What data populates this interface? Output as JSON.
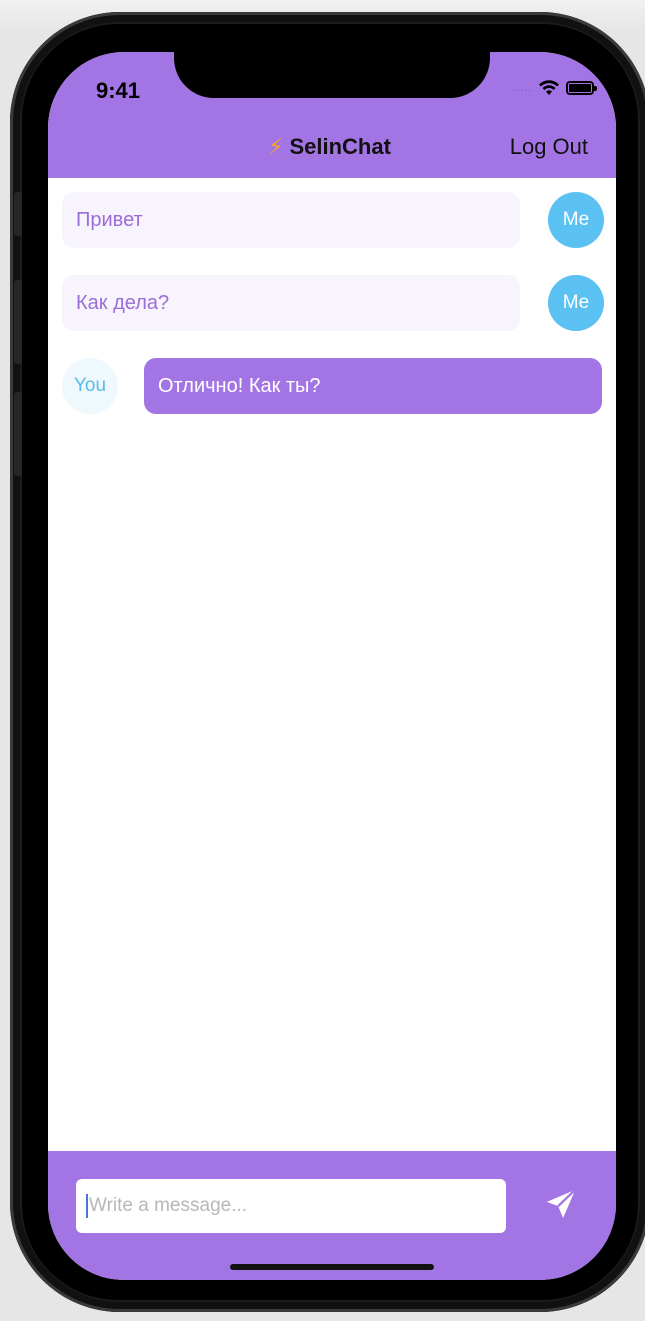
{
  "status_bar": {
    "time": "9:41",
    "signal": "....."
  },
  "header": {
    "title": "SelinChat",
    "title_icon": "lightning-bolt",
    "logout_label": "Log Out"
  },
  "messages": [
    {
      "sender": "me",
      "text": "Привет",
      "avatar": "Me"
    },
    {
      "sender": "me",
      "text": "Как дела?",
      "avatar": "Me"
    },
    {
      "sender": "you",
      "text": "Отлично! Как ты?",
      "avatar": "You"
    }
  ],
  "composer": {
    "placeholder": "Write a message...",
    "send_icon": "paper-plane"
  },
  "colors": {
    "accent": "#a374e3",
    "me_avatar": "#5bc0f2",
    "me_bubble": "#f8f4fd",
    "me_text": "#9a6dd8"
  }
}
